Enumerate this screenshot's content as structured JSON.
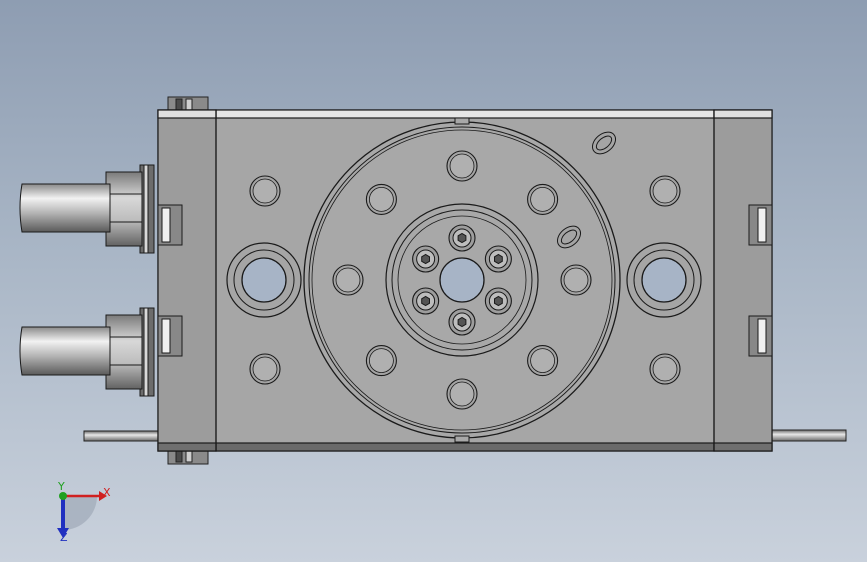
{
  "triad": {
    "x_label": "X",
    "y_label": "Y",
    "z_label": "Z",
    "x_color": "#d02020",
    "y_color": "#20a020",
    "z_color": "#2030c0"
  },
  "colors": {
    "background_top": "#8e9db2",
    "background_bottom": "#c9d1dc",
    "body": "#a9a9a9",
    "body_dark": "#7d7d7d",
    "hole": "#a7b4c6",
    "edge": "#1a1a1a"
  }
}
